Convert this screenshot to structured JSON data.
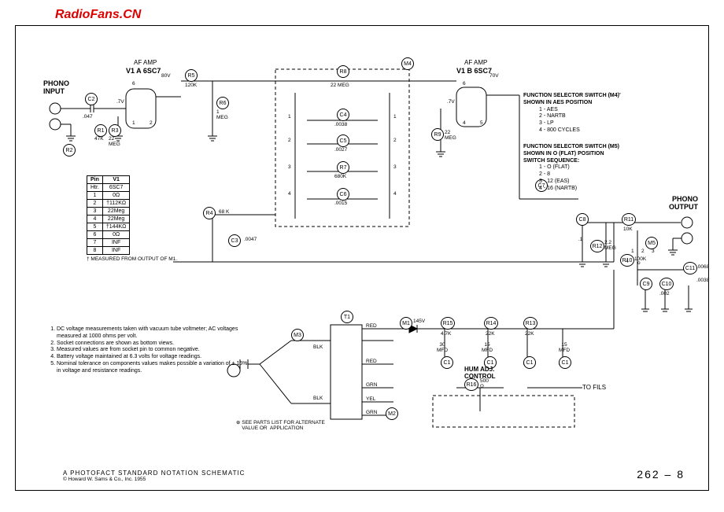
{
  "watermark": "RadioFans.CN",
  "labels": {
    "af_amp_a": "AF AMP",
    "af_amp_b": "AF AMP",
    "tube_a": "V1 A 6SC7",
    "tube_b": "V1 B 6SC7",
    "phono_input": "PHONO\nINPUT",
    "phono_output": "PHONO\nOUTPUT",
    "hum_adj": "HUM ADJ.\nCONTROL",
    "to_fils": "TO FILS",
    "see_parts": "⊕ SEE PARTS LIST FOR ALTERNATE\n    VALUE OR  APPLICATION"
  },
  "components": {
    "R1": "47K",
    "R2": "",
    "R3": "22\nMEG",
    "R4": "68 K",
    "R5": "120K",
    "R6": "1\nMEG",
    "R7": "680K",
    "R8": "22 MEG",
    "R9": "22\nMEG",
    "R10": "100K",
    "R11": "10K",
    "R12": "2.2\nMEG",
    "R13": "22K",
    "R14": "22K",
    "R15": "4.7K",
    "R16": "500\nΩ",
    "C1": "15\nMFD",
    "C1b": "15\nMFD",
    "C1c": "30\nMFD",
    "C2": ".047",
    "C3": ".0047",
    "C4": ".0038",
    "C5": ".0027",
    "C6": ".0015",
    "C7": "",
    "C8": ".1",
    "C9": "",
    "C10": ".002",
    "C11": ".0068",
    "C11b": ".0038",
    "M1": "145V",
    "M4": "",
    "M5": "",
    "T1": "",
    "M2": "",
    "M3": ""
  },
  "voltages": {
    "v80": "80V",
    "v70": "70V",
    "v7a": ".7V",
    "v7b": ".7V"
  },
  "tube_pins": {
    "a": [
      "6",
      "1",
      "2"
    ],
    "b": [
      "6",
      "4",
      "5"
    ]
  },
  "switch_pins": {
    "left": [
      "1",
      "2",
      "3",
      "4"
    ],
    "right": [
      "1",
      "2",
      "3",
      "4"
    ]
  },
  "m5_pins": [
    "1",
    "2",
    "3",
    "4",
    "o"
  ],
  "transformer_wires": [
    "RED",
    "BLK",
    "RED",
    "BLK",
    "GRN",
    "YEL",
    "GRN"
  ],
  "pin_table": {
    "caption_footer": "† MEASURED FROM OUTPUT OF M1.",
    "headers": [
      "Pin",
      "V1"
    ],
    "rows": [
      [
        "Htr.",
        "6SC7"
      ],
      [
        "1",
        "0Ω"
      ],
      [
        "2",
        "†112KΩ"
      ],
      [
        "3",
        "22Meg"
      ],
      [
        "4",
        "22Meg"
      ],
      [
        "5",
        "†144KΩ"
      ],
      [
        "6",
        "0Ω"
      ],
      [
        "7",
        "INF"
      ],
      [
        "8",
        "INF"
      ]
    ]
  },
  "notes": [
    "DC voltage measurements taken with vacuum tube voltmeter; AC voltages measured at 1000 ohms per volt.",
    "Socket connections are shown as bottom views.",
    "Measured values are from socket pin to common negative.",
    "Battery voltage maintained at 6.3 volts for voltage readings.",
    "Nominal tolerance on components values makes possible a variation of ± 15% in voltage and resistance readings."
  ],
  "func_switch_m4": {
    "title": "FUNCTION SELECTOR SWITCH (M4)'\nSHOWN IN AES POSITION",
    "items": [
      "1 - AES",
      "2 - NARTB",
      "3 - LP",
      "4 - 800 CYCLES"
    ]
  },
  "func_switch_m5": {
    "title": "FUNCTION SELECTOR SWITCH (M5)\nSHOWN IN O (FLAT) POSITION\nSWITCH SEQUENCE:",
    "items": [
      "1 - O (FLAT)",
      "2 - 8",
      "3 - 12 (EAS)",
      "4 - 16 (NARTB)"
    ]
  },
  "footer": {
    "title": "A  PHOTOFACT  STANDARD  NOTATION  SCHEMATIC",
    "copyright": "© Howard  W. Sams & Co., Inc.  1955",
    "sheet": "262 – 8"
  }
}
